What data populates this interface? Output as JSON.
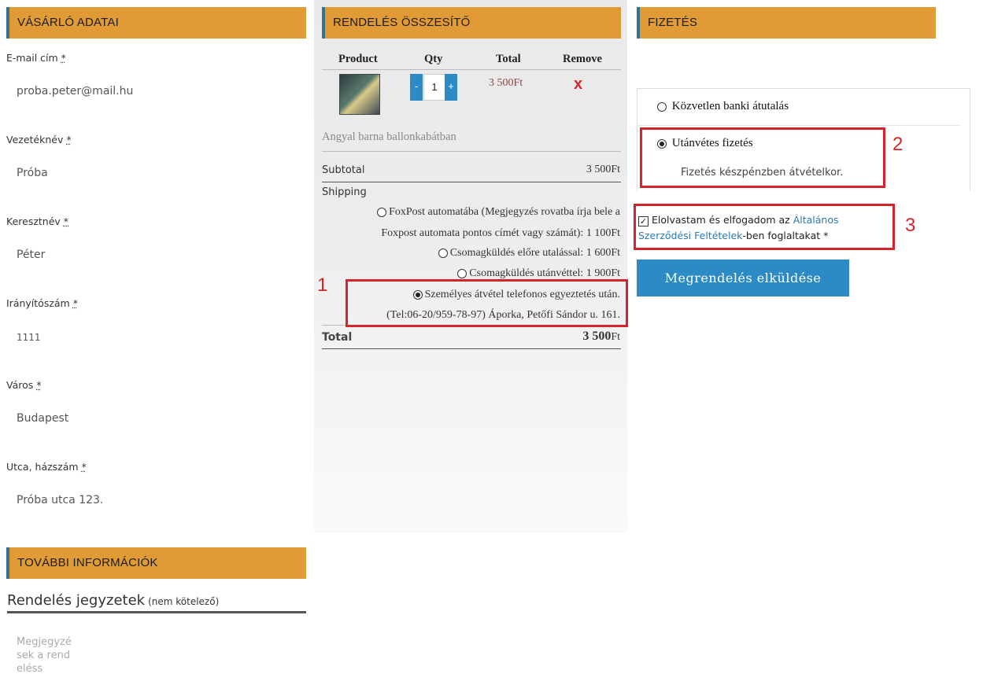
{
  "customer": {
    "header": "VÁSÁRLÓ ADATAI",
    "fields": [
      {
        "label": "E-mail cím",
        "value": "proba.peter@mail.hu"
      },
      {
        "label": "Vezetéknév",
        "value": "Próba"
      },
      {
        "label": "Keresztnév",
        "value": "Péter"
      },
      {
        "label": "Irányítószám",
        "value": "1111"
      },
      {
        "label": "Város",
        "value": "Budapest"
      },
      {
        "label": "Utca, házszám",
        "value": "Próba utca 123."
      }
    ],
    "required_mark": "*"
  },
  "extra": {
    "header": "TOVÁBBI INFORMÁCIÓK",
    "notes_title": "Rendelés jegyzetek",
    "notes_optional": "(nem kötelező)",
    "notes_placeholder": "Megjegyzések a rendeléss"
  },
  "summary": {
    "header": "RENDELÉS ÖSSZESÍTŐ",
    "columns": [
      "Product",
      "Qty",
      "Total",
      "Remove"
    ],
    "item": {
      "name": "Angyal barna ballonkabátban",
      "qty": "1",
      "minus": "-",
      "plus": "+",
      "total": "3 500Ft",
      "remove": "x"
    },
    "subtotal_label": "Subtotal",
    "subtotal_value": "3 500Ft",
    "shipping_label": "Shipping",
    "shipping_options": [
      {
        "line1": "FoxPost automatába (Megjegyzés rovatba írja bele a",
        "line2": "Foxpost automata pontos címét vagy számát): 1 100Ft",
        "selected": false
      },
      {
        "line1": "Csomagküldés előre utalással: 1 600Ft",
        "selected": false
      },
      {
        "line1": "Csomagküldés utánvéttel: 1 900Ft",
        "selected": false
      },
      {
        "line1": "Személyes átvétel telefonos egyeztetés után.",
        "line2": "(Tel:06-20/959-78-97) Áporka, Petőfi Sándor u. 161.",
        "selected": true
      }
    ],
    "total_label": "Total",
    "total_value": "3 500",
    "total_currency": "Ft"
  },
  "payment": {
    "header": "FIZETÉS",
    "options": [
      {
        "label": "Közvetlen banki átutalás",
        "selected": false
      },
      {
        "label": "Utánvétes fizetés",
        "selected": true,
        "description": "Fizetés készpénzben átvételkor."
      }
    ],
    "terms_prefix": "Elolvastam és elfogadom az ",
    "terms_link": "Általános Szerződési Feltételek",
    "terms_suffix": "-ben foglaltakat *",
    "submit_label": "Megrendelés elküldése"
  },
  "annotations": [
    "1",
    "2",
    "3"
  ],
  "colors": {
    "header_bg": "#e09a36",
    "accent_blue": "#2c8bc4",
    "annotation_red": "#d6242c"
  }
}
